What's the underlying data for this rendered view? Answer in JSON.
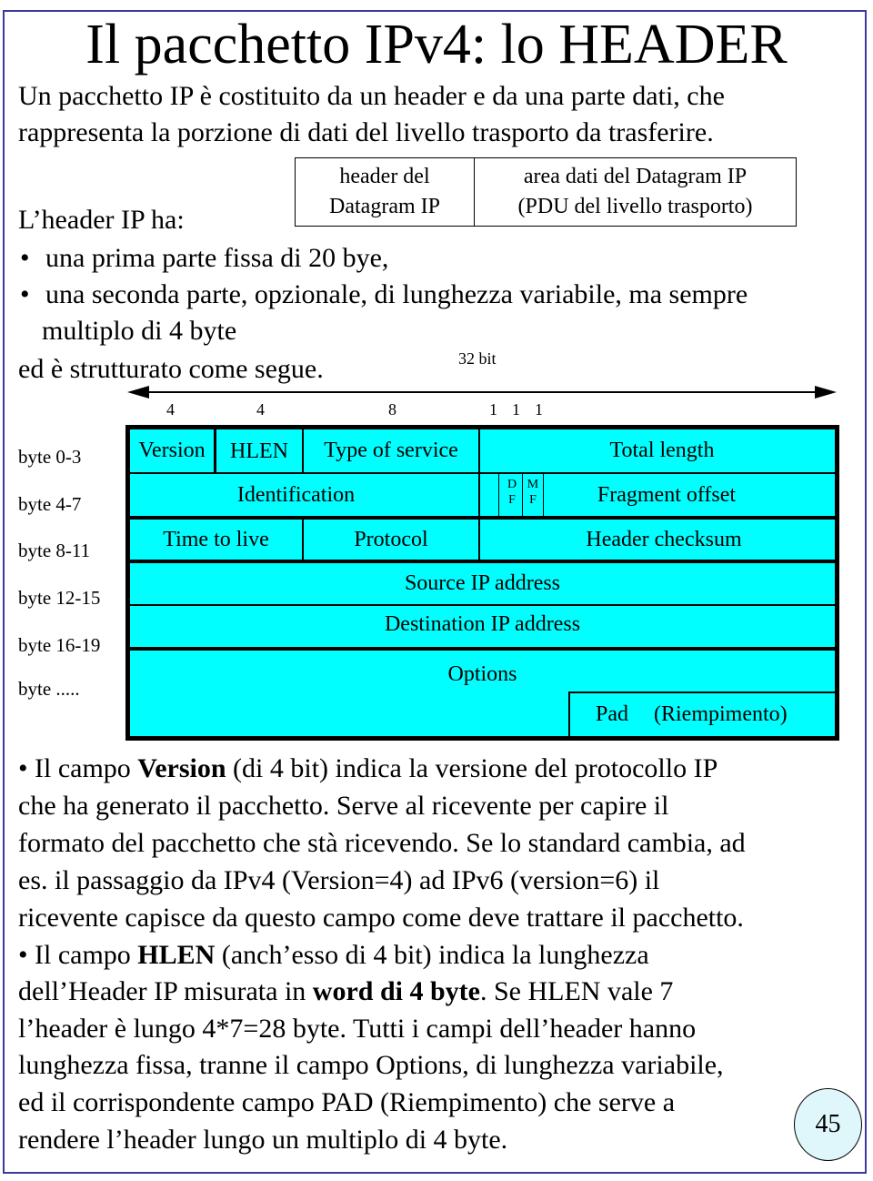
{
  "slide": {
    "title": "Il pacchetto IPv4: lo HEADER",
    "intro_lines": [
      "Un pacchetto IP è costituito da un header e da una parte dati, che",
      "rappresenta la porzione di dati del livello trasporto da trasferire."
    ],
    "header_ha": "L’header IP ha:",
    "bullets": [
      "una prima parte fissa di 20 bye,",
      "una seconda parte, opzionale, di lunghezza variabile, ma sempre",
      "multiplo di 4 byte"
    ],
    "structured": "ed è strutturato come segue.",
    "page_number": "45"
  },
  "datagram_box": {
    "header_cell": [
      "header del",
      "Datagram IP"
    ],
    "data_cell": [
      "area dati del Datagram IP",
      "(PDU del livello trasporto)"
    ]
  },
  "diagram": {
    "width_label": "32 bit",
    "bit_widths": [
      "4",
      "4",
      "8",
      "1",
      "1",
      "1"
    ],
    "byte_labels": [
      "byte 0-3",
      "byte 4-7",
      "byte 8-11",
      "byte 12-15",
      "byte 16-19",
      "byte ....."
    ],
    "fields": {
      "version": "Version",
      "hlen": "HLEN",
      "tos": "Type of service",
      "total_length": "Total length",
      "identification": "Identification",
      "df": [
        "D",
        "F"
      ],
      "mf": [
        "M",
        "F"
      ],
      "fragment_offset": "Fragment offset",
      "ttl": "Time to live",
      "protocol": "Protocol",
      "checksum": "Header checksum",
      "source": "Source IP address",
      "destination": "Destination IP address",
      "options": "Options",
      "pad": "Pad",
      "pad_note": "(Riempimento)"
    },
    "fill_color": "#00ffff"
  },
  "explanation": {
    "version_para": {
      "l1_pre": "• Il campo ",
      "l1_bold": "Version",
      "l1_post": " (di 4 bit) indica la versione del protocollo IP",
      "l2": "che ha generato il pacchetto. Serve al ricevente per capire il",
      "l3": "formato del pacchetto che stà ricevendo. Se lo standard cambia, ad",
      "l4": "es. il passaggio da IPv4 (Version=4) ad IPv6 (version=6) il",
      "l5": "ricevente capisce da questo campo come deve trattare il pacchetto."
    },
    "hlen_para": {
      "l1_pre": "• Il campo ",
      "l1_bold": "HLEN",
      "l1_post": " (anch’esso di 4 bit) indica la lunghezza",
      "l2_pre": "dell’Header IP  misurata in ",
      "l2_bold": "word di 4 byte",
      "l2_post": ". Se HLEN vale 7",
      "l3": "l’header è lungo 4*7=28 byte. Tutti i campi dell’header hanno",
      "l4": "lunghezza fissa, tranne il campo Options, di lunghezza variabile,",
      "l5": "ed il corrispondente campo PAD (Riempimento) che serve a",
      "l6": "rendere l’header lungo un multiplo di 4 byte."
    }
  }
}
